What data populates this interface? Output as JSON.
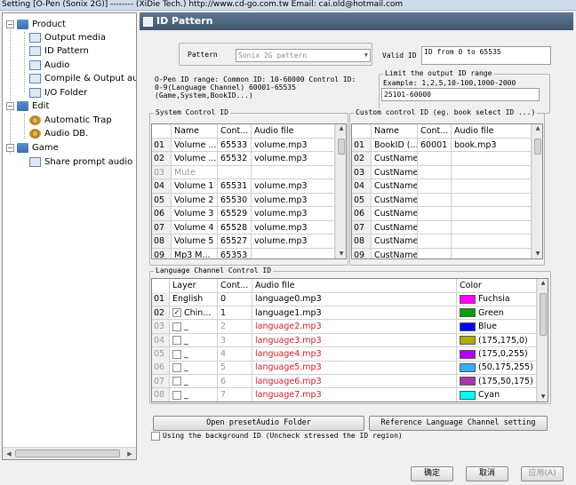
{
  "window": {
    "title": "Setting [O-Pen (Sonix 2G)] -------- (XiDie Tech.) http://www.cd-go.com.tw Email: cai.old@hotmail.com"
  },
  "tree": {
    "items": [
      {
        "label": "Product",
        "expander": "−",
        "icon": "folder-icon"
      },
      {
        "label": "Output media",
        "icon": "page-icon"
      },
      {
        "label": "ID Pattern",
        "icon": "page-icon"
      },
      {
        "label": "Audio",
        "icon": "page-icon"
      },
      {
        "label": "Compile & Output audio",
        "icon": "page-icon"
      },
      {
        "label": "I/O Folder",
        "icon": "page-icon"
      },
      {
        "label": "Edit",
        "expander": "−",
        "icon": "folder-icon"
      },
      {
        "label": "Automatic Trap",
        "icon": "gear-icon"
      },
      {
        "label": "Audio DB.",
        "icon": "gear-icon"
      },
      {
        "label": "Game",
        "expander": "−",
        "icon": "folder-icon"
      },
      {
        "label": "Share prompt audio (Sy",
        "icon": "page-icon"
      }
    ]
  },
  "panel": {
    "title": "ID Pattern",
    "pattern_label": "Pattern",
    "pattern_value": "Sonix 2G pattern",
    "valid_id_label": "Valid ID",
    "valid_id_value": "ID from 0 to 65535",
    "info_line1": "O-Pen ID range:  Common ID: 10-60000  Control ID:",
    "info_line2": "0-9(Language Channel)   60001-65535",
    "info_line3": "(Game,System,BookID...)",
    "limit_group": "Limit the output ID range",
    "limit_example": "Example: 1,2,5,10-100,1000-2000",
    "limit_value": "25101-60000",
    "system_group": "System Control ID",
    "custom_group": "Custom control ID (eg. book select ID ...)",
    "language_group": "Language Channel Control ID",
    "open_preset_button": "Open presetAudio Folder",
    "reference_button": "Reference Language Channel setting",
    "background_id_label": "Using the background ID (Uncheck stressed the ID region)"
  },
  "system_table": {
    "headers": [
      "Name",
      "Cont...",
      "Audio file"
    ],
    "rows": [
      {
        "num": "01",
        "name": "Volume ...",
        "cont": "65533",
        "audio": "volume.mp3",
        "grey": false
      },
      {
        "num": "02",
        "name": "Volume ...",
        "cont": "65532",
        "audio": "volume.mp3",
        "grey": false
      },
      {
        "num": "03",
        "name": "Mute",
        "cont": "",
        "audio": "",
        "grey": true
      },
      {
        "num": "04",
        "name": "Volume 1",
        "cont": "65531",
        "audio": "volume.mp3",
        "grey": false
      },
      {
        "num": "05",
        "name": "Volume 2",
        "cont": "65530",
        "audio": "volume.mp3",
        "grey": false
      },
      {
        "num": "06",
        "name": "Volume 3",
        "cont": "65529",
        "audio": "volume.mp3",
        "grey": false
      },
      {
        "num": "07",
        "name": "Volume 4",
        "cont": "65528",
        "audio": "volume.mp3",
        "grey": false
      },
      {
        "num": "08",
        "name": "Volume 5",
        "cont": "65527",
        "audio": "volume.mp3",
        "grey": false
      },
      {
        "num": "09",
        "name": "Mp3 M...",
        "cont": "65353",
        "audio": "",
        "grey": false
      }
    ]
  },
  "custom_table": {
    "headers": [
      "Name",
      "Cont...",
      "Audio file"
    ],
    "rows": [
      {
        "num": "01",
        "name": "BookID (...",
        "cont": "60001",
        "audio": "book.mp3"
      },
      {
        "num": "02",
        "name": "CustName",
        "cont": "",
        "audio": ""
      },
      {
        "num": "03",
        "name": "CustName",
        "cont": "",
        "audio": ""
      },
      {
        "num": "04",
        "name": "CustName",
        "cont": "",
        "audio": ""
      },
      {
        "num": "05",
        "name": "CustName",
        "cont": "",
        "audio": ""
      },
      {
        "num": "06",
        "name": "CustName",
        "cont": "",
        "audio": ""
      },
      {
        "num": "07",
        "name": "CustName",
        "cont": "",
        "audio": ""
      },
      {
        "num": "08",
        "name": "CustName",
        "cont": "",
        "audio": ""
      },
      {
        "num": "09",
        "name": "CustName",
        "cont": "",
        "audio": ""
      }
    ]
  },
  "language_table": {
    "headers": [
      "Layer",
      "Cont...",
      "Audio file",
      "Color"
    ],
    "rows": [
      {
        "num": "01",
        "layer": "English",
        "checkbox": false,
        "checked": false,
        "cont": "0",
        "audio": "language0.mp3",
        "red": false,
        "grey": false,
        "color_name": "Fuchsia",
        "color": "#ff00ff"
      },
      {
        "num": "02",
        "layer": "Chin...",
        "checkbox": true,
        "checked": true,
        "cont": "1",
        "audio": "language1.mp3",
        "red": false,
        "grey": false,
        "color_name": "Green",
        "color": "#00a000"
      },
      {
        "num": "03",
        "layer": "_",
        "checkbox": true,
        "checked": false,
        "cont": "2",
        "audio": "language2.mp3",
        "red": true,
        "grey": true,
        "color_name": "Blue",
        "color": "#0000ff"
      },
      {
        "num": "04",
        "layer": "_",
        "checkbox": true,
        "checked": false,
        "cont": "3",
        "audio": "language3.mp3",
        "red": true,
        "grey": true,
        "color_name": "(175,175,0)",
        "color": "#afaf00"
      },
      {
        "num": "05",
        "layer": "_",
        "checkbox": true,
        "checked": false,
        "cont": "4",
        "audio": "language4.mp3",
        "red": true,
        "grey": true,
        "color_name": "(175,0,255)",
        "color": "#af00ff"
      },
      {
        "num": "06",
        "layer": "_",
        "checkbox": true,
        "checked": false,
        "cont": "5",
        "audio": "language5.mp3",
        "red": true,
        "grey": true,
        "color_name": "(50,175,255)",
        "color": "#32afff"
      },
      {
        "num": "07",
        "layer": "_",
        "checkbox": true,
        "checked": false,
        "cont": "6",
        "audio": "language6.mp3",
        "red": true,
        "grey": true,
        "color_name": "(175,50,175)",
        "color": "#af32af"
      },
      {
        "num": "08",
        "layer": "_",
        "checkbox": true,
        "checked": false,
        "cont": "7",
        "audio": "language7.mp3",
        "red": true,
        "grey": true,
        "color_name": "Cyan",
        "color": "#00ffff"
      }
    ]
  },
  "footer": {
    "ok": "确定",
    "cancel": "取消",
    "apply": "应用(A)"
  }
}
